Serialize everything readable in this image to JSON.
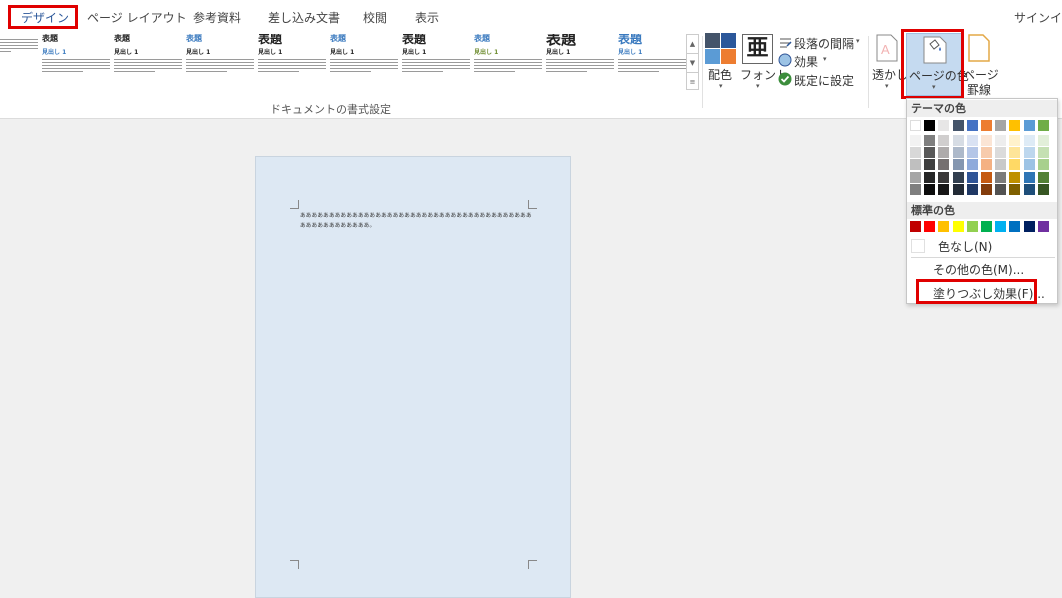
{
  "tabs": [
    "デザイン",
    "ページ レイアウト",
    "参考資料",
    "差し込み文書",
    "校閲",
    "表示"
  ],
  "signin": "サインイン",
  "gallery": {
    "group_label": "ドキュメントの書式設定",
    "items": [
      {
        "title": "",
        "heading": "",
        "title_style": "plain",
        "heading_style": "plain"
      },
      {
        "title": "表題",
        "heading": "見出し 1",
        "title_style": "plain",
        "heading_style": "blue"
      },
      {
        "title": "表題",
        "heading": "見出し 1",
        "title_style": "plain",
        "heading_style": "plain"
      },
      {
        "title": "表題",
        "heading": "見出し 1",
        "title_style": "blue",
        "heading_style": "plain"
      },
      {
        "title": "表題",
        "heading": "見出し 1",
        "title_style": "big",
        "heading_style": "plain"
      },
      {
        "title": "表題",
        "heading": "見出し 1",
        "title_style": "blue",
        "heading_style": "plain"
      },
      {
        "title": "表題",
        "heading": "見出し 1",
        "title_style": "big",
        "heading_style": "plain"
      },
      {
        "title": "表題",
        "heading": "見出し 1",
        "title_style": "blue",
        "heading_style": "green"
      },
      {
        "title": "表題",
        "heading": "見出し 1",
        "title_style": "bigger",
        "heading_style": "plain"
      },
      {
        "title": "表題",
        "heading": "見出し 1",
        "title_style": "bigblue",
        "heading_style": "blue"
      }
    ]
  },
  "ribbon": {
    "colors_label": "配色",
    "fonts_label": "フォント",
    "fonts_glyph": "亜",
    "paragraph_spacing_label": "段落の間隔",
    "effects_label": "効果",
    "set_default_label": "既定に設定",
    "watermark_label": "透かし",
    "page_color_label": "ページの色",
    "page_borders_label_1": "ページ",
    "page_borders_label_2": "罫線",
    "caret": "▾"
  },
  "document": {
    "text": "ああああああああああああああああああああああああああああああああああああああああああああああああああああ。"
  },
  "dropdown": {
    "theme_colors_label": "テーマの色",
    "standard_colors_label": "標準の色",
    "no_color_label": "色なし(N)",
    "more_colors_label": "その他の色(M)...",
    "fill_effects_label": "塗りつぶし効果(F)...",
    "theme_top_row": [
      "#ffffff",
      "#000000",
      "#e7e6e6",
      "#44546a",
      "#4472c4",
      "#ed7d31",
      "#a5a5a5",
      "#ffc000",
      "#5b9bd5",
      "#70ad47"
    ],
    "theme_shades": [
      [
        "#f2f2f2",
        "#7f7f7f",
        "#d0cece",
        "#d6dce4",
        "#d9e2f3",
        "#fbe5d5",
        "#ededed",
        "#fff2cc",
        "#deebf6",
        "#e2efd9"
      ],
      [
        "#d8d8d8",
        "#595959",
        "#aeabab",
        "#adb9ca",
        "#b4c6e7",
        "#f7cbac",
        "#dbdbdb",
        "#fee599",
        "#bdd7ee",
        "#c5e0b3"
      ],
      [
        "#bfbfbf",
        "#3f3f3f",
        "#757070",
        "#8496b0",
        "#8eaadb",
        "#f4b183",
        "#c9c9c9",
        "#ffd965",
        "#9cc3e5",
        "#a8d08d"
      ],
      [
        "#a5a5a5",
        "#262626",
        "#3a3838",
        "#323f4f",
        "#2f5496",
        "#c55a11",
        "#7b7b7b",
        "#bf9000",
        "#2e75b5",
        "#538135"
      ],
      [
        "#7f7f7f",
        "#0c0c0c",
        "#171616",
        "#222a35",
        "#1f3864",
        "#833c0b",
        "#525252",
        "#7f6000",
        "#1e4e79",
        "#375623"
      ]
    ],
    "standard_colors": [
      "#c00000",
      "#ff0000",
      "#ffc000",
      "#ffff00",
      "#92d050",
      "#00b050",
      "#00b0f0",
      "#0070c0",
      "#002060",
      "#7030a0"
    ]
  },
  "colors": {
    "highlight_red": "#e00000",
    "page_fill": "#dde8f3",
    "accent_blue": "#2b579a"
  }
}
